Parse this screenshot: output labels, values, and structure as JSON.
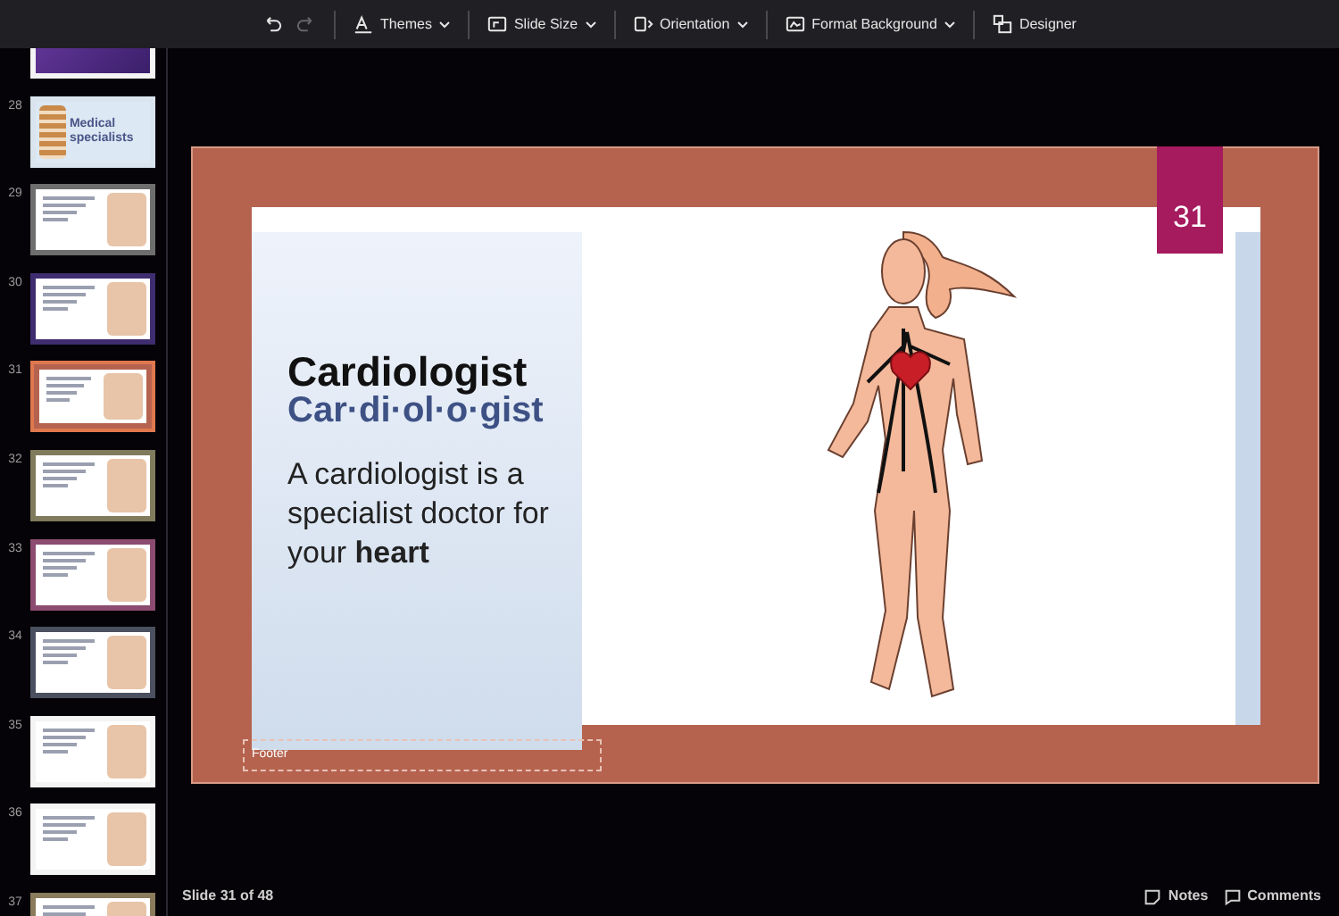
{
  "toolbar": {
    "history": [
      {
        "kind": "undo",
        "disabled": false
      },
      {
        "kind": "redo",
        "disabled": true
      }
    ],
    "items": [
      {
        "kind": "themes",
        "label": "Themes",
        "dropdown": true
      },
      {
        "kind": "size",
        "label": "Slide Size",
        "dropdown": true
      },
      {
        "kind": "orientation",
        "label": "Orientation",
        "dropdown": true
      },
      {
        "kind": "background",
        "label": "Format Background",
        "dropdown": true
      },
      {
        "kind": "designer",
        "label": "Designer",
        "dropdown": false
      }
    ]
  },
  "thumbnails": [
    {
      "color": "#f4f4f4",
      "selected": false,
      "kind": "dark"
    },
    {
      "number": "28",
      "color": "#d9e4ef",
      "selected": false,
      "kind": "title",
      "title": "Medical specialists"
    },
    {
      "number": "29",
      "color": "#6e6e6e",
      "selected": false,
      "kind": "content"
    },
    {
      "number": "30",
      "color": "#3f2d70",
      "selected": false,
      "kind": "content"
    },
    {
      "number": "31",
      "color": "#b5634f",
      "selected": true,
      "kind": "content"
    },
    {
      "number": "32",
      "color": "#7f7b5c",
      "selected": false,
      "kind": "content"
    },
    {
      "number": "33",
      "color": "#8c4b70",
      "selected": false,
      "kind": "content"
    },
    {
      "number": "34",
      "color": "#4b5060",
      "selected": false,
      "kind": "content"
    },
    {
      "number": "35",
      "color": "#f4f4f4",
      "selected": false,
      "kind": "content"
    },
    {
      "number": "36",
      "color": "#f4f4f4",
      "selected": false,
      "kind": "content"
    },
    {
      "number": "37",
      "color": "#8a7b5c",
      "selected": false,
      "kind": "content"
    }
  ],
  "slide": {
    "number": "31",
    "title": "Cardiologist",
    "syllables": "Car·di·ol·o·gist",
    "body": "A cardiologist is a specialist doctor for your **heart**",
    "footer": "Footer"
  },
  "status_bar": {
    "position": "Slide 31 of 48",
    "buttons": [
      {
        "kind": "notes",
        "label": "Notes"
      },
      {
        "kind": "comments",
        "label": "Comments"
      }
    ]
  }
}
